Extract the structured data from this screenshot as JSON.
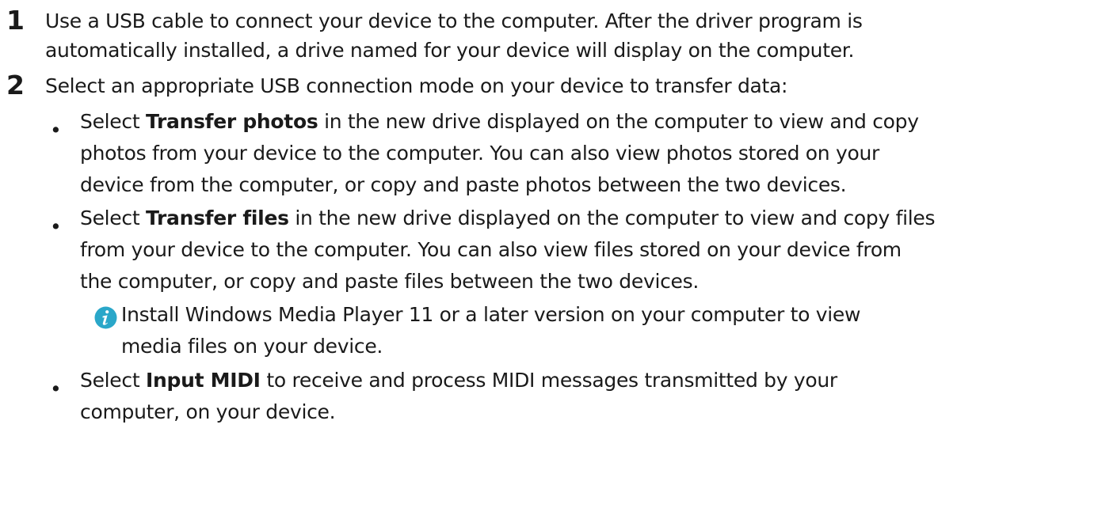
{
  "steps": [
    {
      "number": "1",
      "lines": [
        "Use a USB cable to connect your device to the computer. After the driver program is",
        "automatically installed, a drive named for your device will display on the computer."
      ]
    },
    {
      "number": "2",
      "lines": [
        "Select an appropriate USB connection mode on your device to transfer data:"
      ]
    }
  ],
  "bullets": [
    {
      "dot": "•",
      "prefix": "Select ",
      "bold": "Transfer photos",
      "suffix": " in the new drive displayed on the computer to view and copy",
      "lines": [
        "photos from your device to the computer. You can also view photos stored on your",
        "device from the computer, or copy and paste photos between the two devices."
      ]
    },
    {
      "dot": "•",
      "prefix": "Select ",
      "bold": "Transfer files",
      "suffix": " in the new drive displayed on the computer to view and copy files",
      "lines": [
        "from your device to the computer. You can also view files stored on your device from",
        "the computer, or copy and paste files between the two devices."
      ]
    },
    {
      "dot": "•",
      "prefix": "Select ",
      "bold": "Input MIDI",
      "suffix": " to receive and process MIDI messages transmitted by your",
      "lines": [
        "computer, on your device."
      ]
    }
  ],
  "note": {
    "icon": "info-icon",
    "icon_color": "#2aa7c9",
    "lines": [
      "Install Windows Media Player 11 or a later version on your computer to view",
      "media files on your device."
    ]
  }
}
